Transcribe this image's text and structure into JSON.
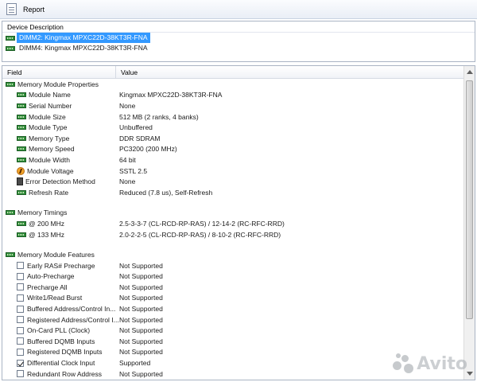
{
  "window": {
    "title": "Report",
    "icon": "report-icon"
  },
  "devices": {
    "header": "Device Description",
    "items": [
      {
        "label": "DIMM2: Kingmax MPXC22D-38KT3R-FNA",
        "selected": true,
        "icon": "memory-chip-icon"
      },
      {
        "label": "DIMM4: Kingmax MPXC22D-38KT3R-FNA",
        "selected": false,
        "icon": "memory-chip-icon"
      }
    ]
  },
  "table": {
    "columns": [
      "Field",
      "Value"
    ],
    "groups": [
      {
        "title": "Memory Module Properties",
        "icon": "memory-chip-icon",
        "rows": [
          {
            "field": "Module Name",
            "value": "Kingmax MPXC22D-38KT3R-FNA",
            "icon": "memory-chip-icon"
          },
          {
            "field": "Serial Number",
            "value": "None",
            "icon": "memory-chip-icon"
          },
          {
            "field": "Module Size",
            "value": "512 MB (2 ranks, 4 banks)",
            "icon": "memory-chip-icon"
          },
          {
            "field": "Module Type",
            "value": "Unbuffered",
            "icon": "memory-chip-icon"
          },
          {
            "field": "Memory Type",
            "value": "DDR SDRAM",
            "icon": "memory-chip-icon"
          },
          {
            "field": "Memory Speed",
            "value": "PC3200 (200 MHz)",
            "icon": "memory-chip-icon"
          },
          {
            "field": "Module Width",
            "value": "64 bit",
            "icon": "memory-chip-icon"
          },
          {
            "field": "Module Voltage",
            "value": "SSTL 2.5",
            "icon": "voltage-icon"
          },
          {
            "field": "Error Detection Method",
            "value": "None",
            "icon": "error-detection-icon"
          },
          {
            "field": "Refresh Rate",
            "value": "Reduced (7.8 us), Self-Refresh",
            "icon": "memory-chip-icon"
          }
        ]
      },
      {
        "title": "Memory Timings",
        "icon": "memory-chip-icon",
        "rows": [
          {
            "field": "@ 200 MHz",
            "value": "2.5-3-3-7  (CL-RCD-RP-RAS) / 12-14-2  (RC-RFC-RRD)",
            "icon": "memory-chip-icon"
          },
          {
            "field": "@ 133 MHz",
            "value": "2.0-2-2-5  (CL-RCD-RP-RAS) / 8-10-2  (RC-RFC-RRD)",
            "icon": "memory-chip-icon"
          }
        ]
      },
      {
        "title": "Memory Module Features",
        "icon": "memory-chip-icon",
        "rows": [
          {
            "field": "Early RAS# Precharge",
            "value": "Not Supported",
            "checked": false
          },
          {
            "field": "Auto-Precharge",
            "value": "Not Supported",
            "checked": false
          },
          {
            "field": "Precharge All",
            "value": "Not Supported",
            "checked": false
          },
          {
            "field": "Write1/Read Burst",
            "value": "Not Supported",
            "checked": false
          },
          {
            "field": "Buffered Address/Control In...",
            "value": "Not Supported",
            "checked": false
          },
          {
            "field": "Registered Address/Control I...",
            "value": "Not Supported",
            "checked": false
          },
          {
            "field": "On-Card PLL (Clock)",
            "value": "Not Supported",
            "checked": false
          },
          {
            "field": "Buffered DQMB Inputs",
            "value": "Not Supported",
            "checked": false
          },
          {
            "field": "Registered DQMB Inputs",
            "value": "Not Supported",
            "checked": false
          },
          {
            "field": "Differential Clock Input",
            "value": "Supported",
            "checked": true
          },
          {
            "field": "Redundant Row Address",
            "value": "Not Supported",
            "checked": false
          }
        ]
      }
    ]
  },
  "watermark": {
    "text": "Avito",
    "icon": "avito-dots-icon"
  }
}
